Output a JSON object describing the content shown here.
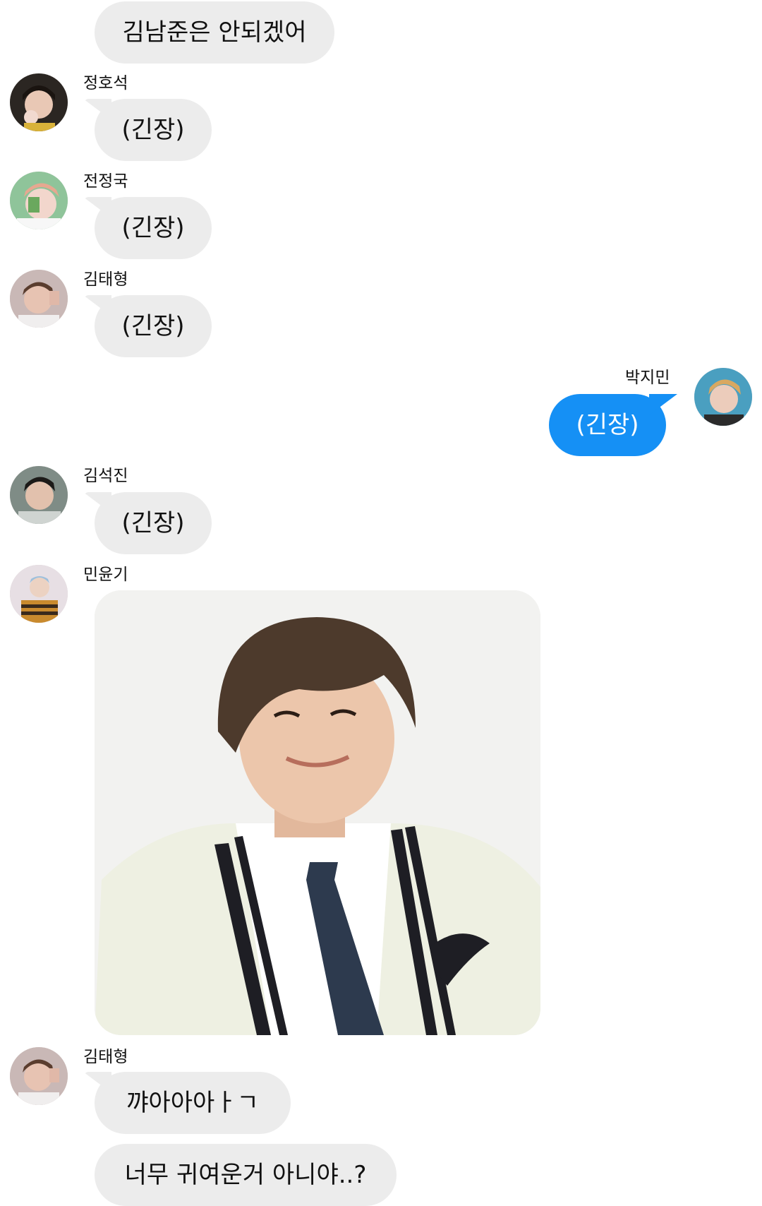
{
  "messages": [
    {
      "kind": "text",
      "text": "김남준은 안되겠어"
    },
    {
      "kind": "text",
      "sender": "정호석",
      "text": "(긴장)",
      "avatar_icon": "member-avatar-icon"
    },
    {
      "kind": "text",
      "sender": "전정국",
      "text": "(긴장)",
      "avatar_icon": "member-avatar-icon"
    },
    {
      "kind": "text",
      "sender": "김태형",
      "text": "(긴장)",
      "avatar_icon": "member-avatar-icon"
    },
    {
      "kind": "text",
      "sender": "박지민",
      "text": "(긴장)",
      "mine": true,
      "avatar_icon": "member-avatar-icon"
    },
    {
      "kind": "text",
      "sender": "김석진",
      "text": "(긴장)",
      "avatar_icon": "member-avatar-icon"
    },
    {
      "kind": "image",
      "sender": "민윤기",
      "image_icon": "boy-in-cardigan-photo",
      "avatar_icon": "member-avatar-icon"
    },
    {
      "kind": "text",
      "sender": "김태형",
      "text": "꺄아아아ㅏㄱ",
      "avatar_icon": "member-avatar-icon"
    },
    {
      "kind": "text",
      "text": "너무 귀여운거 아니야..?"
    }
  ],
  "colors": {
    "received_bubble": "#ececec",
    "sent_bubble": "#1590f5",
    "background": "#ffffff"
  }
}
